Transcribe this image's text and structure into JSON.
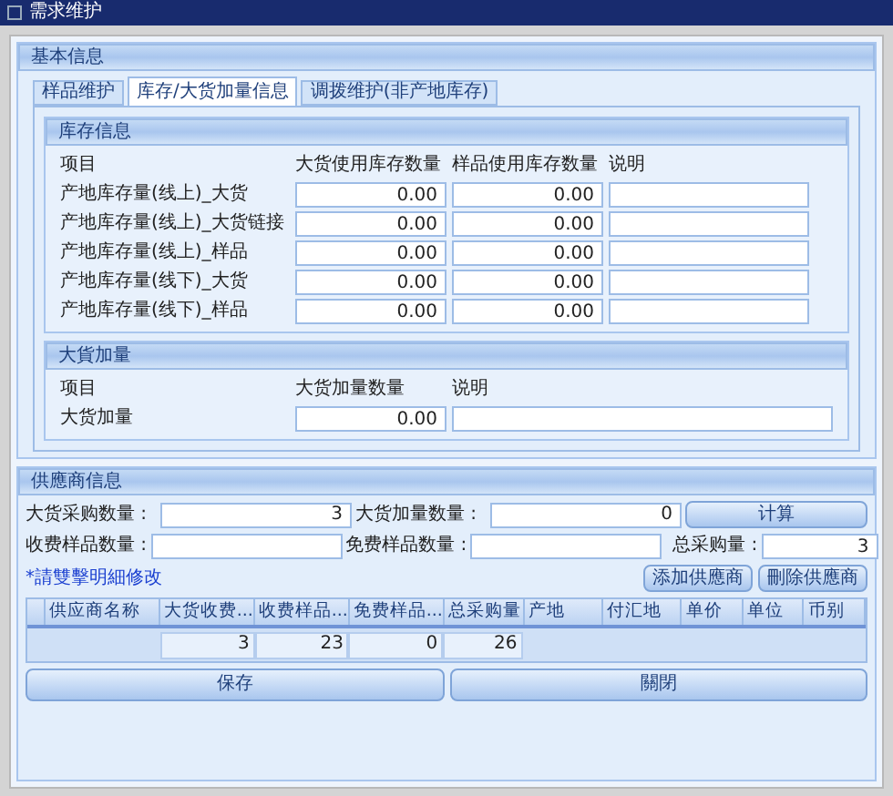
{
  "window": {
    "title": "需求维护"
  },
  "basic_info": {
    "title": "基本信息",
    "tabs": [
      {
        "label": "样品维护",
        "selected": false
      },
      {
        "label": "库存/大货加量信息",
        "selected": true
      },
      {
        "label": "调拨维护(非产地库存)",
        "selected": false
      }
    ],
    "inventory": {
      "title": "库存信息",
      "columns": [
        "项目",
        "大货使用库存数量",
        "样品使用库存数量",
        "说明"
      ],
      "rows": [
        {
          "label": "产地库存量(线上)_大货",
          "bulk": "0.00",
          "sample": "0.00"
        },
        {
          "label": "产地库存量(线上)_大货链接",
          "bulk": "0.00",
          "sample": "0.00"
        },
        {
          "label": "产地库存量(线上)_样品",
          "bulk": "0.00",
          "sample": "0.00"
        },
        {
          "label": "产地库存量(线下)_大货",
          "bulk": "0.00",
          "sample": "0.00"
        },
        {
          "label": "产地库存量(线下)_样品",
          "bulk": "0.00",
          "sample": "0.00"
        }
      ]
    },
    "bulk_addition": {
      "title": "大貨加量",
      "columns": [
        "项目",
        "大货加量数量",
        "说明"
      ],
      "rows": [
        {
          "label": "大货加量",
          "quantity": "0.00"
        }
      ]
    }
  },
  "supplier_info": {
    "title": "供應商信息",
    "bulk_purchase": {
      "label": "大货采购数量 :",
      "value": "3"
    },
    "bulk_addition": {
      "label": "大货加量数量 :",
      "value": "0"
    },
    "calculate_button": "计算",
    "charged_samples": {
      "label": "收费样品数量 :"
    },
    "free_samples": {
      "label": "免费样品数量 :"
    },
    "total_purchase": {
      "label": "总采购量 :",
      "value": "3"
    },
    "note": "*請雙擊明細修改",
    "add_button": "添加供應商",
    "delete_button": "刪除供應商",
    "table": {
      "columns": [
        "供应商名称",
        "大货收费...",
        "收费样品...",
        "免费样品...",
        "总采购量",
        "产地",
        "付汇地",
        "单价",
        "单位",
        "币别"
      ],
      "summary_row": [
        "3",
        "23",
        "0",
        "26"
      ]
    }
  },
  "footer_buttons": [
    "保存",
    "關閉"
  ]
}
